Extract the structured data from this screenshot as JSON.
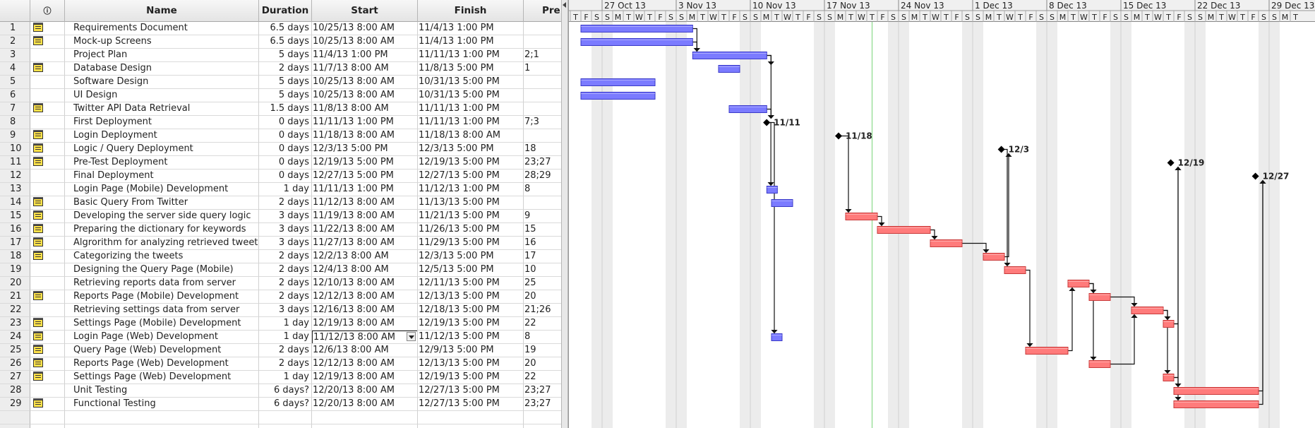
{
  "table": {
    "columns": {
      "indicator_header": "ⓘ",
      "name": "Name",
      "duration": "Duration",
      "start": "Start",
      "finish": "Finish",
      "predecessors": "Pre"
    },
    "rows": [
      {
        "id": "1",
        "note": true,
        "name": "Requirements Document",
        "duration": "6.5 days",
        "start": "10/25/13 8:00 AM",
        "finish": "11/4/13 1:00 PM",
        "pred": ""
      },
      {
        "id": "2",
        "note": true,
        "name": "Mock-up Screens",
        "duration": "6.5 days",
        "start": "10/25/13 8:00 AM",
        "finish": "11/4/13 1:00 PM",
        "pred": ""
      },
      {
        "id": "3",
        "note": false,
        "name": "Project Plan",
        "duration": "5 days",
        "start": "11/4/13 1:00 PM",
        "finish": "11/11/13 1:00 PM",
        "pred": "2;1"
      },
      {
        "id": "4",
        "note": true,
        "name": "Database Design",
        "duration": "2 days",
        "start": "11/7/13 8:00 AM",
        "finish": "11/8/13 5:00 PM",
        "pred": "1"
      },
      {
        "id": "5",
        "note": false,
        "name": "Software Design",
        "duration": "5 days",
        "start": "10/25/13 8:00 AM",
        "finish": "10/31/13 5:00 PM",
        "pred": ""
      },
      {
        "id": "6",
        "note": false,
        "name": "UI Design",
        "duration": "5 days",
        "start": "10/25/13 8:00 AM",
        "finish": "10/31/13 5:00 PM",
        "pred": ""
      },
      {
        "id": "7",
        "note": true,
        "name": "Twitter API Data Retrieval",
        "duration": "1.5 days",
        "start": "11/8/13 8:00 AM",
        "finish": "11/11/13 1:00 PM",
        "pred": ""
      },
      {
        "id": "8",
        "note": false,
        "name": "First Deployment",
        "duration": "0 days",
        "start": "11/11/13 1:00 PM",
        "finish": "11/11/13 1:00 PM",
        "pred": "7;3"
      },
      {
        "id": "9",
        "note": true,
        "name": "Login Deployment",
        "duration": "0 days",
        "start": "11/18/13 8:00 AM",
        "finish": "11/18/13 8:00 AM",
        "pred": ""
      },
      {
        "id": "10",
        "note": true,
        "name": "Logic / Query Deployment",
        "duration": "0 days",
        "start": "12/3/13 5:00 PM",
        "finish": "12/3/13 5:00 PM",
        "pred": "18"
      },
      {
        "id": "11",
        "note": true,
        "name": "Pre-Test Deployment",
        "duration": "0 days",
        "start": "12/19/13 5:00 PM",
        "finish": "12/19/13 5:00 PM",
        "pred": "23;27"
      },
      {
        "id": "12",
        "note": false,
        "name": "Final Deployment",
        "duration": "0 days",
        "start": "12/27/13 5:00 PM",
        "finish": "12/27/13 5:00 PM",
        "pred": "28;29"
      },
      {
        "id": "13",
        "note": false,
        "name": "Login Page (Mobile) Development",
        "duration": "1 day",
        "start": "11/11/13 1:00 PM",
        "finish": "11/12/13 1:00 PM",
        "pred": "8"
      },
      {
        "id": "14",
        "note": true,
        "name": "Basic Query From Twitter",
        "duration": "2 days",
        "start": "11/12/13 8:00 AM",
        "finish": "11/13/13 5:00 PM",
        "pred": ""
      },
      {
        "id": "15",
        "note": true,
        "name": "Developing the server side query logic",
        "duration": "3 days",
        "start": "11/19/13 8:00 AM",
        "finish": "11/21/13 5:00 PM",
        "pred": "9"
      },
      {
        "id": "16",
        "note": true,
        "name": "Preparing the dictionary for keywords",
        "duration": "3 days",
        "start": "11/22/13 8:00 AM",
        "finish": "11/26/13 5:00 PM",
        "pred": "15"
      },
      {
        "id": "17",
        "note": true,
        "name": "Algrorithm for analyzing retrieved tweets",
        "duration": "3 days",
        "start": "11/27/13 8:00 AM",
        "finish": "11/29/13 5:00 PM",
        "pred": "16"
      },
      {
        "id": "18",
        "note": true,
        "name": "Categorizing the tweets",
        "duration": "2 days",
        "start": "12/2/13 8:00 AM",
        "finish": "12/3/13 5:00 PM",
        "pred": "17"
      },
      {
        "id": "19",
        "note": false,
        "name": "Designing the Query Page (Mobile)",
        "duration": "2 days",
        "start": "12/4/13 8:00 AM",
        "finish": "12/5/13 5:00 PM",
        "pred": "10"
      },
      {
        "id": "20",
        "note": false,
        "name": "Retrieving reports data from server",
        "duration": "2 days",
        "start": "12/10/13 8:00 AM",
        "finish": "12/11/13 5:00 PM",
        "pred": "25"
      },
      {
        "id": "21",
        "note": true,
        "name": "Reports Page (Mobile) Development",
        "duration": "2 days",
        "start": "12/12/13 8:00 AM",
        "finish": "12/13/13 5:00 PM",
        "pred": "20"
      },
      {
        "id": "22",
        "note": false,
        "name": "Retrieving settings data from server",
        "duration": "3 days",
        "start": "12/16/13 8:00 AM",
        "finish": "12/18/13 5:00 PM",
        "pred": "21;26"
      },
      {
        "id": "23",
        "note": true,
        "name": "Settings Page (Mobile) Development",
        "duration": "1 day",
        "start": "12/19/13 8:00 AM",
        "finish": "12/19/13 5:00 PM",
        "pred": "22"
      },
      {
        "id": "24",
        "note": true,
        "name": "Login Page (Web) Development",
        "duration": "1 day",
        "start": "11/12/13 8:00 AM",
        "finish": "11/12/13 5:00 PM",
        "pred": "8",
        "editing": true
      },
      {
        "id": "25",
        "note": true,
        "name": "Query Page (Web) Development",
        "duration": "2 days",
        "start": "12/6/13 8:00 AM",
        "finish": "12/9/13 5:00 PM",
        "pred": "19"
      },
      {
        "id": "26",
        "note": true,
        "name": "Reports Page (Web) Development",
        "duration": "2 days",
        "start": "12/12/13 8:00 AM",
        "finish": "12/13/13 5:00 PM",
        "pred": "20"
      },
      {
        "id": "27",
        "note": true,
        "name": "Settings Page (Web) Development",
        "duration": "1 day",
        "start": "12/19/13 8:00 AM",
        "finish": "12/19/13 5:00 PM",
        "pred": "22"
      },
      {
        "id": "28",
        "note": false,
        "name": "Unit Testing",
        "duration": "6 days?",
        "start": "12/20/13 8:00 AM",
        "finish": "12/27/13 5:00 PM",
        "pred": "23;27"
      },
      {
        "id": "29",
        "note": true,
        "name": "Functional Testing",
        "duration": "6 days?",
        "start": "12/20/13 8:00 AM",
        "finish": "12/27/13 5:00 PM",
        "pred": "23;27"
      }
    ]
  },
  "gantt": {
    "colors": {
      "normal_bar": "#7b7bff",
      "normal_border": "#3a3ac8",
      "critical_bar": "#ff7b7b",
      "critical_border": "#c83a3a",
      "weekend": "#ececec",
      "today_line": "#7ad47a",
      "link": "#111111"
    },
    "timeline_start": "2013-10-24",
    "timeline_end": "2013-12-31",
    "today": "2013-11-21",
    "week_labels": [
      "27 Oct 13",
      "3 Nov 13",
      "10 Nov 13",
      "17 Nov 13",
      "24 Nov 13",
      "1 Dec 13",
      "8 Dec 13",
      "15 Dec 13",
      "22 Dec 13",
      "29 Dec 13"
    ],
    "day_letters": [
      "S",
      "M",
      "T",
      "W",
      "T",
      "F",
      "S"
    ],
    "tasks": [
      {
        "row": 1,
        "type": "task",
        "critical": false
      },
      {
        "row": 2,
        "type": "task",
        "critical": false
      },
      {
        "row": 3,
        "type": "task",
        "critical": false
      },
      {
        "row": 4,
        "type": "task",
        "critical": false
      },
      {
        "row": 5,
        "type": "task",
        "critical": false
      },
      {
        "row": 6,
        "type": "task",
        "critical": false
      },
      {
        "row": 7,
        "type": "task",
        "critical": false
      },
      {
        "row": 8,
        "type": "milestone",
        "label": "11/11"
      },
      {
        "row": 9,
        "type": "milestone",
        "label": "11/18"
      },
      {
        "row": 10,
        "type": "milestone",
        "label": "12/3"
      },
      {
        "row": 11,
        "type": "milestone",
        "label": "12/19"
      },
      {
        "row": 12,
        "type": "milestone",
        "label": "12/27"
      },
      {
        "row": 13,
        "type": "task",
        "critical": false
      },
      {
        "row": 14,
        "type": "task",
        "critical": false
      },
      {
        "row": 15,
        "type": "task",
        "critical": true
      },
      {
        "row": 16,
        "type": "task",
        "critical": true
      },
      {
        "row": 17,
        "type": "task",
        "critical": true
      },
      {
        "row": 18,
        "type": "task",
        "critical": true
      },
      {
        "row": 19,
        "type": "task",
        "critical": true
      },
      {
        "row": 20,
        "type": "task",
        "critical": true
      },
      {
        "row": 21,
        "type": "task",
        "critical": true
      },
      {
        "row": 22,
        "type": "task",
        "critical": true
      },
      {
        "row": 23,
        "type": "task",
        "critical": true
      },
      {
        "row": 24,
        "type": "task",
        "critical": false
      },
      {
        "row": 25,
        "type": "task",
        "critical": true
      },
      {
        "row": 26,
        "type": "task",
        "critical": true
      },
      {
        "row": 27,
        "type": "task",
        "critical": true
      },
      {
        "row": 28,
        "type": "task",
        "critical": true
      },
      {
        "row": 29,
        "type": "task",
        "critical": true
      }
    ],
    "links": [
      [
        1,
        3
      ],
      [
        2,
        3
      ],
      [
        3,
        4
      ],
      [
        3,
        8
      ],
      [
        7,
        8
      ],
      [
        8,
        13
      ],
      [
        8,
        24
      ],
      [
        9,
        15
      ],
      [
        15,
        16
      ],
      [
        16,
        17
      ],
      [
        17,
        18
      ],
      [
        18,
        10
      ],
      [
        10,
        19
      ],
      [
        19,
        25
      ],
      [
        25,
        20
      ],
      [
        20,
        21
      ],
      [
        20,
        26
      ],
      [
        21,
        22
      ],
      [
        26,
        22
      ],
      [
        22,
        23
      ],
      [
        22,
        27
      ],
      [
        23,
        11
      ],
      [
        27,
        11
      ],
      [
        23,
        28
      ],
      [
        27,
        29
      ],
      [
        28,
        12
      ],
      [
        29,
        12
      ]
    ]
  }
}
